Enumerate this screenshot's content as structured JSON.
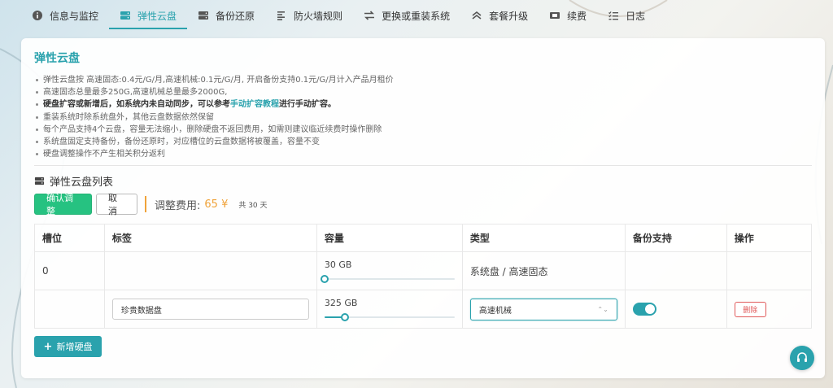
{
  "tabs": [
    {
      "label": "信息与监控",
      "icon": "info-icon",
      "active": false
    },
    {
      "label": "弹性云盘",
      "icon": "disk-icon",
      "active": true
    },
    {
      "label": "备份还原",
      "icon": "backup-icon",
      "active": false
    },
    {
      "label": "防火墙规则",
      "icon": "firewall-list-icon",
      "active": false
    },
    {
      "label": "更换或重装系统",
      "icon": "swap-icon",
      "active": false
    },
    {
      "label": "套餐升级",
      "icon": "upgrade-icon",
      "active": false
    },
    {
      "label": "续费",
      "icon": "renew-icon",
      "active": false
    },
    {
      "label": "日志",
      "icon": "log-icon",
      "active": false
    }
  ],
  "card": {
    "title": "弹性云盘",
    "notes": [
      "弹性云盘按 高速固态:0.4元/G/月,高速机械:0.1元/G/月, 开启备份支持0.1元/G/月计入产品月租价",
      "高速固态总量最多250G,高速机械总量最多2000G,",
      "重装系统时除系统盘外，其他云盘数据依然保留",
      "每个产品支持4个云盘，容量无法缩小，删除硬盘不返回费用，如需则建议临近续费时操作删除",
      "系统盘固定支持备份，备份还原时，对应槽位的云盘数据将被覆盖，容量不变",
      "硬盘调整操作不产生相关积分返利"
    ],
    "strong_note": {
      "before": "硬盘扩容或新增后，如系统内未自动同步，可以参考",
      "link": "手动扩容教程",
      "after": "进行手动扩容。"
    },
    "list_title": "弹性云盘列表",
    "confirm_label": "确认调整",
    "cancel_label": "取消",
    "fee_label": "调整费用:",
    "fee_value": "65 ¥",
    "fee_days": "共 30 天",
    "add_label": "新增硬盘"
  },
  "table": {
    "headers": [
      "槽位",
      "标签",
      "容量",
      "类型",
      "备份支持",
      "操作"
    ],
    "rows": [
      {
        "slot": "0",
        "label_value": "",
        "capacity": "30 GB",
        "capacity_fraction": 0.0,
        "type": "系统盘 / 高速固态",
        "backup": null,
        "action": ""
      },
      {
        "slot": "",
        "label_value": "珍贵数据盘",
        "capacity": "325 GB",
        "capacity_fraction": 0.16,
        "type": "高速机械",
        "backup": true,
        "action": "删除"
      }
    ]
  },
  "colors": {
    "accent": "#2aa2ad",
    "confirm": "#26c281",
    "fee": "#f0a33a",
    "danger": "#e05a5a"
  }
}
